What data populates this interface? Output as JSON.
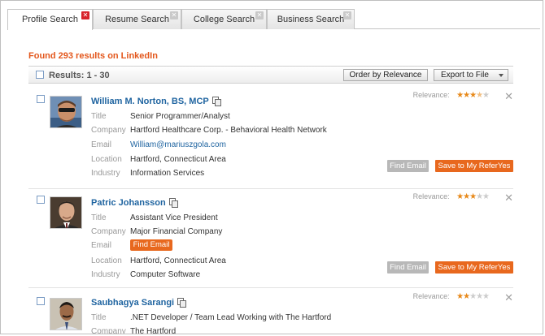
{
  "tabs": [
    {
      "label": "Profile Search",
      "active": true
    },
    {
      "label": "Resume Search",
      "active": false
    },
    {
      "label": "College Search",
      "active": false
    },
    {
      "label": "Business Search",
      "active": false
    }
  ],
  "found_text": "Found 293 results on LinkedIn",
  "results_label": "Results: 1 - 30",
  "order_button": "Order by Relevance",
  "export_button": "Export to File",
  "field_labels": {
    "title": "Title",
    "company": "Company",
    "email": "Email",
    "location": "Location",
    "industry": "Industry"
  },
  "relevance_label": "Relevance:",
  "find_email_label": "Find Email",
  "save_label": "Save to My ReferYes",
  "profiles": [
    {
      "name": "William M. Norton, BS, MCP",
      "title": "Senior Programmer/Analyst",
      "company": "Hartford Healthcare Corp. - Behavioral Health Network",
      "email": "William@mariuszgola.com",
      "location": "Hartford, Connecticut Area",
      "industry": "Information Services",
      "relevance_stars": 3.5
    },
    {
      "name": "Patric Johansson",
      "title": "Assistant Vice President",
      "company": "Major Financial Company",
      "email_button": "Find Email",
      "location": "Hartford, Connecticut Area",
      "industry": "Computer Software",
      "relevance_stars": 3
    },
    {
      "name": "Saubhagya Sarangi",
      "title": ".NET Developer / Team Lead Working with The Hartford",
      "company": "The Hartford",
      "relevance_stars": 2
    }
  ],
  "colors": {
    "accent_orange": "#e8681e",
    "link_blue": "#1f64a0",
    "close_red": "#d8232a"
  }
}
